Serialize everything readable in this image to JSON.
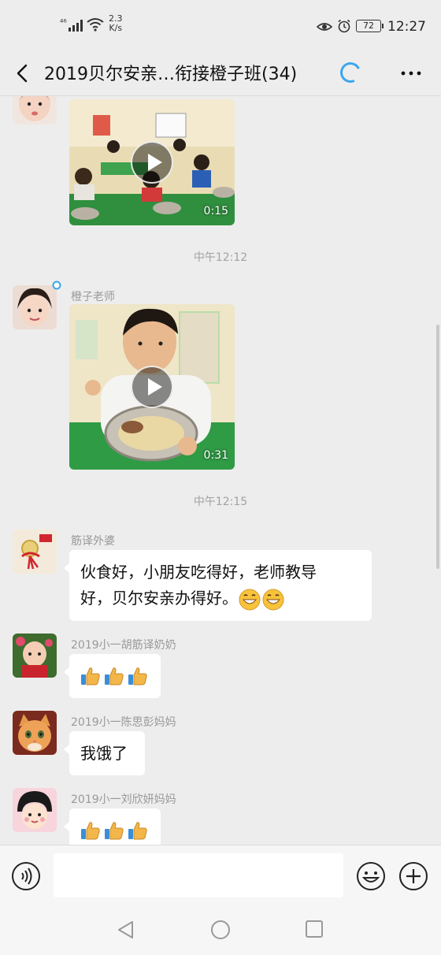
{
  "status_bar": {
    "signal_label": "⁴⁶",
    "speed_value": "2.3",
    "speed_unit": "K/s",
    "battery": "72",
    "time": "12:27"
  },
  "header": {
    "title": "2019贝尔安亲…衔接橙子班(34)"
  },
  "messages": {
    "video1": {
      "duration": "0:15"
    },
    "ts1": "中午12:12",
    "video2": {
      "sender": "橙子老师",
      "duration": "0:31"
    },
    "ts2": "中午12:15",
    "msg3": {
      "sender": "筋译外婆",
      "text_line1": "伙食好，小朋友吃得好，老师教导",
      "text_line2": "好，贝尔安亲办得好。"
    },
    "msg4": {
      "sender": "2019小一胡筋译奶奶"
    },
    "msg5": {
      "sender": "2019小一陈思彭妈妈",
      "text": "我饿了"
    },
    "msg6": {
      "sender": "2019小一刘欣妍妈妈"
    }
  },
  "colors": {
    "accent": "#3aa6ee",
    "background": "#ededed",
    "bubble": "#ffffff"
  }
}
